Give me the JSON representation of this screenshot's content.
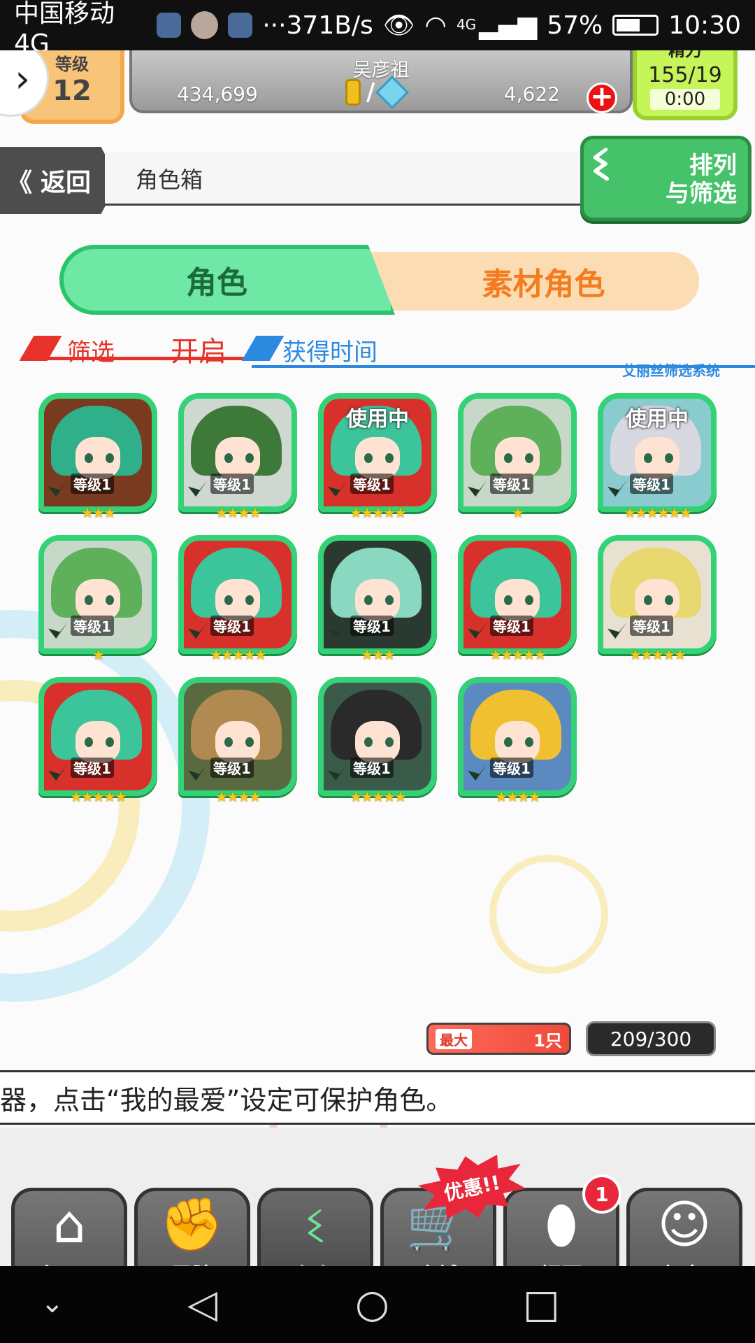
{
  "status_bar": {
    "carrier": "中国移动4G",
    "more": "···",
    "net_speed": "371B/s",
    "signal_type": "4G",
    "battery_pct": "57%",
    "time": "10:30"
  },
  "hud": {
    "level_label": "等级",
    "level": "12",
    "player_name": "吴彦祖",
    "gold": "434,699",
    "separator": "/",
    "gems": "4,622",
    "stamina_label": "精力",
    "stamina": "155/19",
    "stamina_timer": "0:00"
  },
  "nav_header": {
    "back_label": "返回",
    "back_icon": "《",
    "title": "角色箱",
    "sort_label_1": "排列",
    "sort_label_2": "与筛选"
  },
  "tabs": [
    {
      "label": "角色",
      "active": true
    },
    {
      "label": "素材角色",
      "active": false
    }
  ],
  "filter": {
    "label": "筛选",
    "state": "开启",
    "sort_by": "获得时间",
    "system_name": "艾丽丝筛选系统"
  },
  "cards": [
    {
      "level": "等级1",
      "stars": 3,
      "in_use": false,
      "hair": "#2fb08a",
      "bg": "#7a3a20"
    },
    {
      "level": "等级1",
      "stars": 4,
      "in_use": false,
      "hair": "#3d7a3a",
      "bg": "#cfd8d0"
    },
    {
      "level": "等级1",
      "stars": 5,
      "in_use": true,
      "hair": "#3cc49a",
      "bg": "#d8302a"
    },
    {
      "level": "等级1",
      "stars": 1,
      "in_use": false,
      "hair": "#5fb05a",
      "bg": "#c8d8c8"
    },
    {
      "level": "等级1",
      "stars": 6,
      "in_use": true,
      "hair": "#d8d8e0",
      "bg": "#8acbd0"
    },
    {
      "level": "等级1",
      "stars": 1,
      "in_use": false,
      "hair": "#5fb05a",
      "bg": "#c8d8c8"
    },
    {
      "level": "等级1",
      "stars": 5,
      "in_use": false,
      "hair": "#3cc49a",
      "bg": "#d8302a"
    },
    {
      "level": "等级1",
      "stars": 3,
      "in_use": false,
      "hair": "#8ad8c0",
      "bg": "#2a3a30"
    },
    {
      "level": "等级1",
      "stars": 5,
      "in_use": false,
      "hair": "#3cc49a",
      "bg": "#d8302a"
    },
    {
      "level": "等级1",
      "stars": 5,
      "in_use": false,
      "hair": "#e8d870",
      "bg": "#e8e0d0"
    },
    {
      "level": "等级1",
      "stars": 5,
      "in_use": false,
      "hair": "#3cc49a",
      "bg": "#d8302a"
    },
    {
      "level": "等级1",
      "stars": 4,
      "in_use": false,
      "hair": "#b08a50",
      "bg": "#5a6a40"
    },
    {
      "level": "等级1",
      "stars": 5,
      "in_use": false,
      "hair": "#2a2a2a",
      "bg": "#3a5a4a"
    },
    {
      "level": "等级1",
      "stars": 4,
      "in_use": false,
      "hair": "#f0c030",
      "bg": "#5a8ac0"
    }
  ],
  "in_use_label": "使用中",
  "capacity": {
    "max_label": "最大",
    "max_value": "1只",
    "count": "209/300"
  },
  "ticker": "器，点击“我的最爱”设定可保护角色。",
  "bottom_nav": [
    {
      "label": "主画面",
      "icon": "home-icon",
      "glyph": "⌂",
      "active": false
    },
    {
      "label": "冒险",
      "icon": "handshake-icon",
      "glyph": "✊",
      "active": false
    },
    {
      "label": "角色",
      "icon": "bunny-icon",
      "glyph": "ଽ",
      "active": true
    },
    {
      "label": "商城",
      "icon": "cart-icon",
      "glyph": "🛒",
      "active": false
    },
    {
      "label": "扭蛋",
      "icon": "egg-icon",
      "glyph": "⬮",
      "active": false
    },
    {
      "label": "好友",
      "icon": "friends-icon",
      "glyph": "☺",
      "active": false
    }
  ],
  "promo_label": "优惠!!",
  "gacha_badge": "1",
  "colors": {
    "accent_green": "#33d277",
    "tab_orange": "#f47c1e",
    "filter_red": "#e6322a",
    "filter_blue": "#2b8ae0"
  }
}
